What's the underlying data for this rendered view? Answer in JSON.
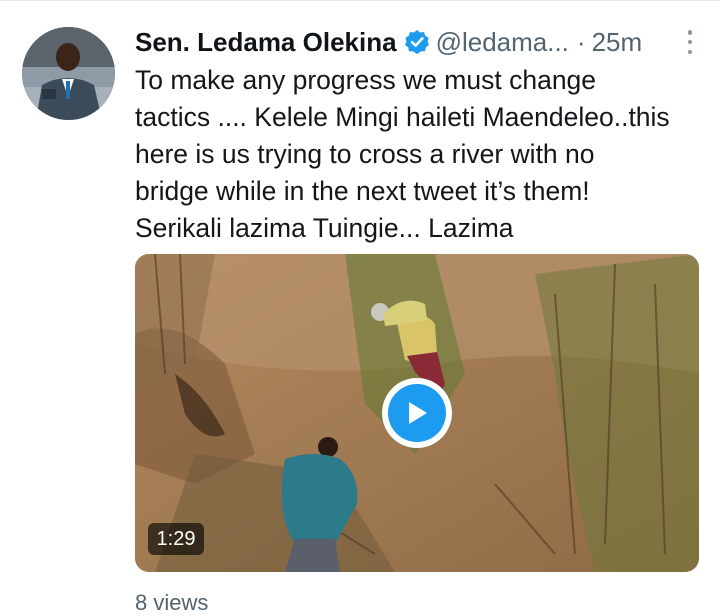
{
  "tweet": {
    "author_name": "Sen. Ledama Olekina",
    "verified": true,
    "handle": "@ledama...",
    "separator": "·",
    "timestamp": "25m",
    "text": "To make any progress we must change\ntactics .... Kelele Mingi haileti Maendeleo..this\nhere is us trying to cross a river with no\nbridge while in the next tweet it’s them!\nSerikali lazima Tuingie... Lazima",
    "video": {
      "duration": "1:29",
      "play_icon": "play-icon"
    },
    "views": "8 views"
  },
  "colors": {
    "verified_badge": "#1d9bf0",
    "play_button": "#1d9bf0",
    "secondary_text": "#536471"
  }
}
